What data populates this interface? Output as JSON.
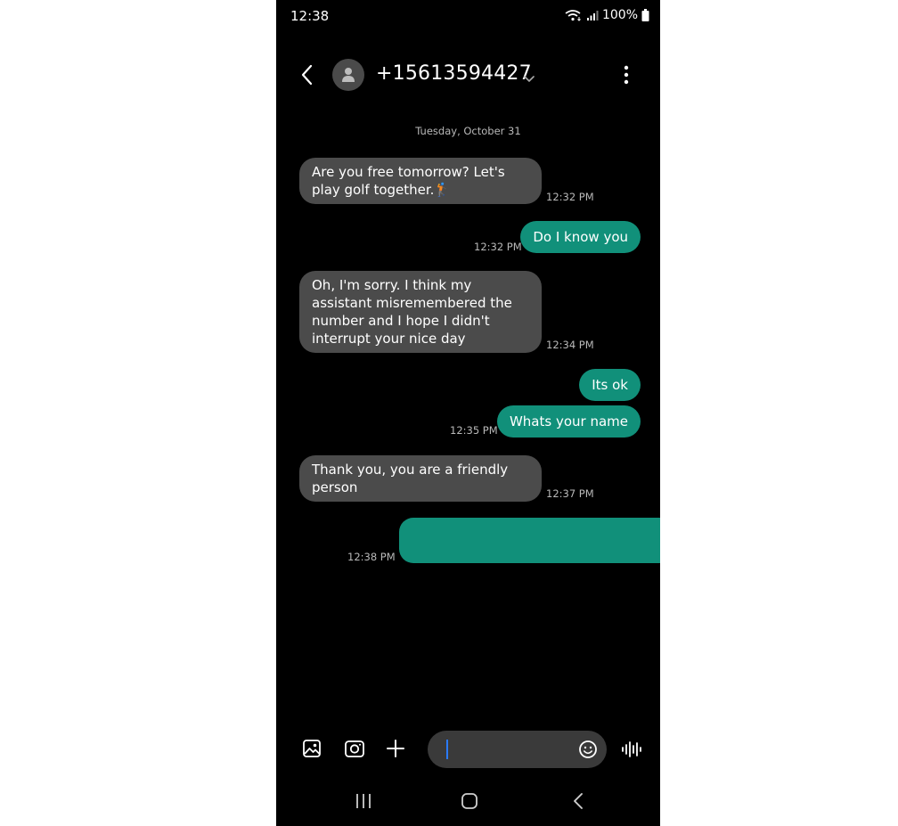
{
  "status_bar": {
    "time": "12:38",
    "battery": "100%"
  },
  "header": {
    "contact": "+15613594427",
    "icons": [
      "back-icon",
      "person-icon",
      "chevron-down-icon",
      "more-vertical-icon"
    ]
  },
  "conversation": {
    "date": "Tuesday, October 31",
    "messages": [
      {
        "dir": "in",
        "text": "Are you free tomorrow? Let's play golf together.🏌",
        "time": "12:32 PM"
      },
      {
        "dir": "out",
        "text": "Do I know you",
        "time": "12:32 PM"
      },
      {
        "dir": "in",
        "text": "Oh, I'm sorry. I think my assistant misremembered the number and I hope I didn't interrupt your nice day",
        "time": "12:34 PM"
      },
      {
        "dir": "out",
        "text": "Its ok",
        "time": ""
      },
      {
        "dir": "out",
        "text": "Whats your name",
        "time": "12:35 PM"
      },
      {
        "dir": "in",
        "text": "Thank you, you are a friendly person",
        "time": "12:37 PM"
      },
      {
        "dir": "out",
        "text": "",
        "time": "12:38 PM",
        "redacted": true
      }
    ]
  },
  "composer": {
    "input_value": "",
    "icons": [
      "gallery-icon",
      "camera-icon",
      "plus-icon",
      "emoji-icon",
      "voice-icon"
    ]
  },
  "nav_bar": {
    "icons": [
      "recents-icon",
      "home-icon",
      "back-nav-icon"
    ]
  },
  "colors": {
    "background": "#000000",
    "incoming_bubble": "#4b4b4b",
    "outgoing_bubble": "#11907a",
    "cursor": "#2a7bff"
  }
}
